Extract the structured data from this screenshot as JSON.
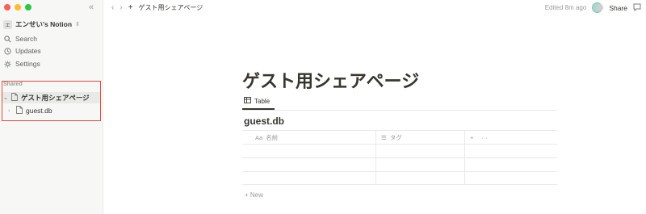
{
  "window": {
    "traffic_lights": [
      "#ff5f57",
      "#febc2e",
      "#28c840"
    ]
  },
  "sidebar": {
    "collapse_icon": "«",
    "workspace": {
      "avatar_letter": "エ",
      "name": "エンせい's Notion"
    },
    "nav": [
      {
        "label": "Search",
        "icon": "search-icon"
      },
      {
        "label": "Updates",
        "icon": "clock-icon"
      },
      {
        "label": "Settings",
        "icon": "gear-icon"
      }
    ],
    "shared_label": "Shared",
    "tree": [
      {
        "label": "ゲスト用シェアページ",
        "caret": "⌄"
      },
      {
        "label": "guest.db",
        "caret": "›"
      }
    ]
  },
  "topbar": {
    "breadcrumb": "ゲスト用シェアページ",
    "edited": "Edited 8m ago",
    "share": "Share"
  },
  "page": {
    "title": "ゲスト用シェアページ",
    "view_tab": "Table",
    "db_title": "guest.db",
    "columns": [
      {
        "prefix": "Aa",
        "label": "名前"
      },
      {
        "prefix": "☰",
        "label": "タグ"
      }
    ],
    "add_column": "+",
    "more": "···",
    "new_row": "+ New"
  }
}
